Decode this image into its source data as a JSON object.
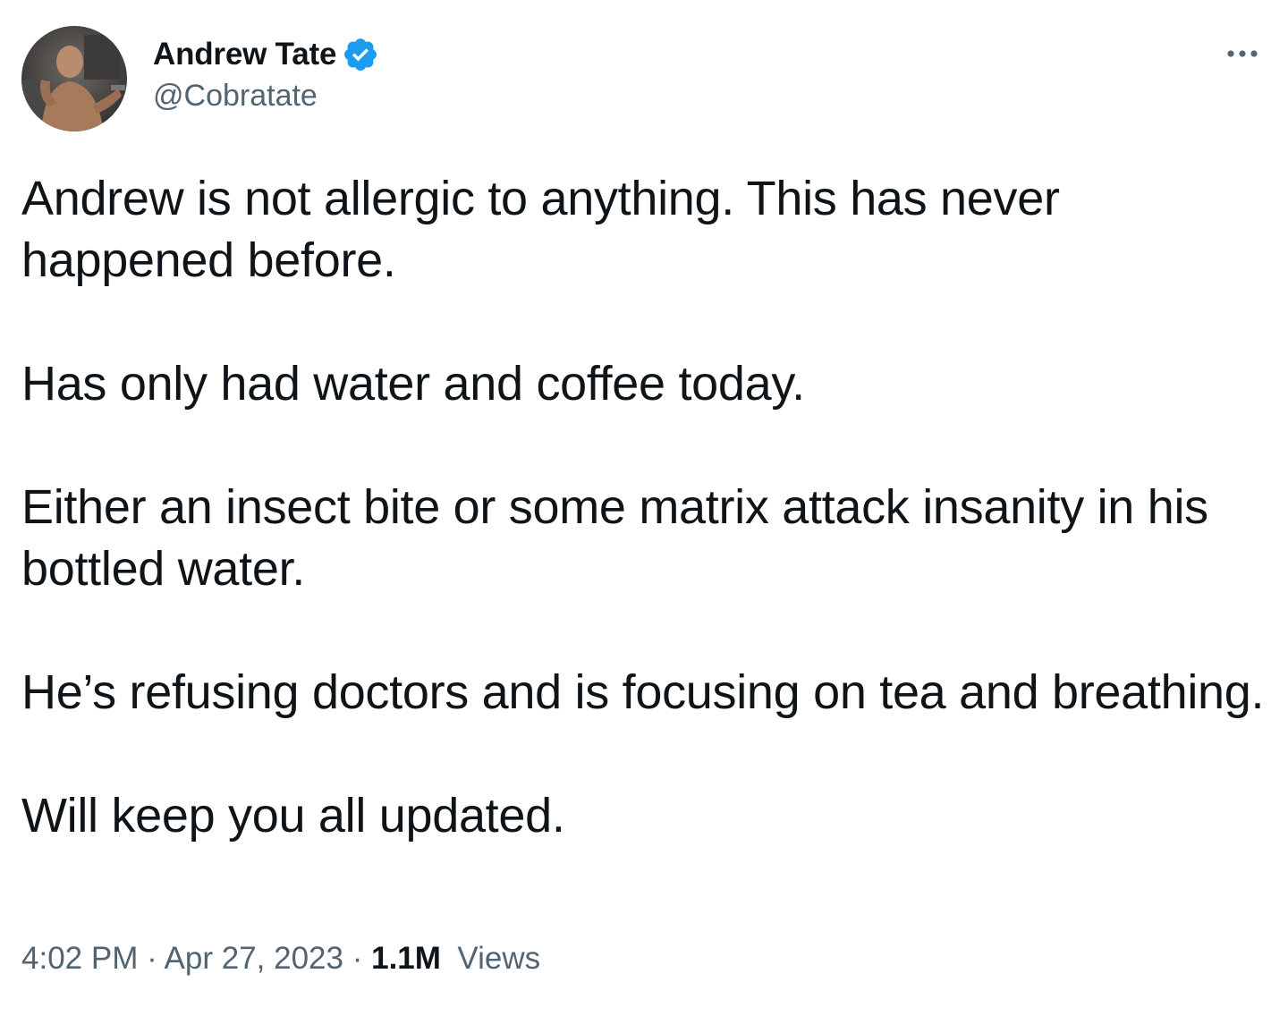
{
  "author": {
    "display_name": "Andrew Tate",
    "handle": "@Cobratate",
    "verified": true
  },
  "tweet": {
    "paragraphs": [
      "Andrew is not allergic to anything. This has never happened before.",
      "Has only had water and coffee today.",
      "Either an insect bite or some matrix attack insanity in his bottled water.",
      "He’s refusing doctors and is focusing on tea and breathing.",
      "Will keep you all updated."
    ]
  },
  "meta": {
    "time": "4:02 PM",
    "separator": "·",
    "date": "Apr 27, 2023",
    "views_count": "1.1M",
    "views_label": "Views"
  },
  "icons": {
    "verified": "verified-badge-icon",
    "more": "more-options-icon"
  },
  "colors": {
    "verified_blue": "#1d9bf0",
    "text_primary": "#0f1419",
    "text_secondary": "#536471"
  }
}
